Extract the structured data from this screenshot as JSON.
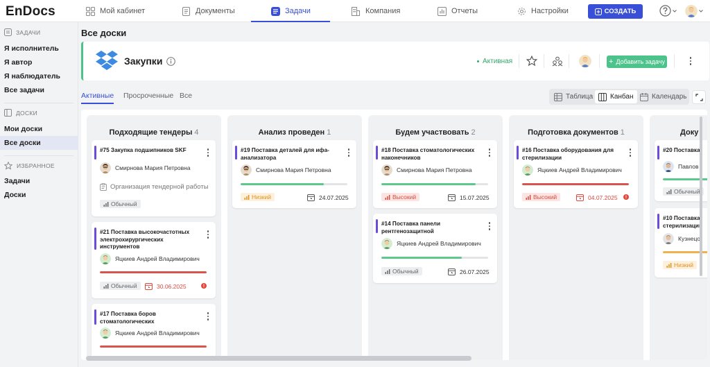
{
  "app": {
    "logo": "EnDocs"
  },
  "nav": [
    {
      "label": "Мой кабинет",
      "icon": "grid-icon"
    },
    {
      "label": "Документы",
      "icon": "document-icon"
    },
    {
      "label": "Задачи",
      "icon": "tasks-icon",
      "active": true
    },
    {
      "label": "Компания",
      "icon": "building-icon"
    },
    {
      "label": "Отчеты",
      "icon": "chart-icon"
    },
    {
      "label": "Настройки",
      "icon": "gear-icon"
    }
  ],
  "header": {
    "create_label": "СОЗДАТЬ"
  },
  "sidebar": {
    "tasks_section": "ЗАДАЧИ",
    "tasks": [
      "Я исполнитель",
      "Я автор",
      "Я наблюдатель",
      "Все задачи"
    ],
    "boards_section": "ДОСКИ",
    "boards": [
      "Мои доски",
      "Все доски"
    ],
    "favorites_section": "ИЗБРАННОЕ",
    "favorites": [
      "Задачи",
      "Доски"
    ]
  },
  "page": {
    "title": "Все доски"
  },
  "board": {
    "name": "Закупки",
    "status": "Активная",
    "add_task_label": "Добавить задачу",
    "accent_color": "#4cc38a"
  },
  "tabs": [
    "Активные",
    "Просроченные",
    "Все"
  ],
  "views": [
    "Таблица",
    "Канбан",
    "Календарь"
  ],
  "columns": [
    {
      "title": "Подходящие тендеры",
      "count": "4",
      "cards": [
        {
          "title": "#75 Закупка подшипников SKF",
          "assignee": "Смирнова Мария Петровна",
          "subtask": "Организация тендерной работы",
          "priority": "Обычный",
          "priority_level": "normal"
        },
        {
          "title": "#21 Поставка высокочастотных электрохирургических инструментов",
          "assignee": "Яцкиев Андрей Владимирович",
          "progress": 1.0,
          "progress_color": "#d9534f",
          "priority": "Обычный",
          "priority_level": "normal",
          "date": "30.06.2025",
          "overdue": true
        },
        {
          "title": "#17 Поставка боров стоматологических",
          "assignee": "Яцкиев Андрей Владимирович",
          "progress": 1.0,
          "progress_color": "#d9534f"
        }
      ]
    },
    {
      "title": "Анализ проведен",
      "count": "1",
      "cards": [
        {
          "title": "#19 Поставка деталей для ифа-анализатора",
          "assignee": "Смирнова Мария Петровна",
          "progress": 0.78,
          "progress_color": "#5cc98b",
          "priority": "Низкий",
          "priority_level": "low",
          "date": "24.07.2025"
        }
      ]
    },
    {
      "title": "Будем участвовать",
      "count": "2",
      "cards": [
        {
          "title": "#18 Поставка стоматологических наконечников",
          "assignee": "Смирнова Мария Петровна",
          "progress": 0.88,
          "progress_color": "#5cc98b",
          "priority": "Высокий",
          "priority_level": "high",
          "date": "15.07.2025"
        },
        {
          "title": "#14 Поставка панели рентгенозащитной",
          "assignee": "Яцкиев Андрей Владимирович",
          "progress": 0.75,
          "progress_color": "#5cc98b",
          "priority": "Обычный",
          "priority_level": "normal",
          "date": "26.07.2025"
        }
      ]
    },
    {
      "title": "Подготовка документов",
      "count": "1",
      "cards": [
        {
          "title": "#16 Поставка оборудования для стерилизации",
          "assignee": "Яцкиев Андрей Владимирович",
          "progress": 1.0,
          "progress_color": "#d9534f",
          "priority": "Высокий",
          "priority_level": "high",
          "date": "04.07.2025",
          "overdue": true
        }
      ]
    },
    {
      "title": "Доку",
      "cards": [
        {
          "title": "#20 Поставка",
          "assignee": "Павлов",
          "progress": 1.0,
          "progress_color": "#5cc98b",
          "priority": "Обычный",
          "priority_level": "normal"
        },
        {
          "title": "#10 Поставка стерилизации",
          "assignee": "Кузнецо",
          "progress": 1.0,
          "progress_color": "#f0b24a",
          "priority": "Низкий",
          "priority_level": "low"
        }
      ]
    }
  ]
}
